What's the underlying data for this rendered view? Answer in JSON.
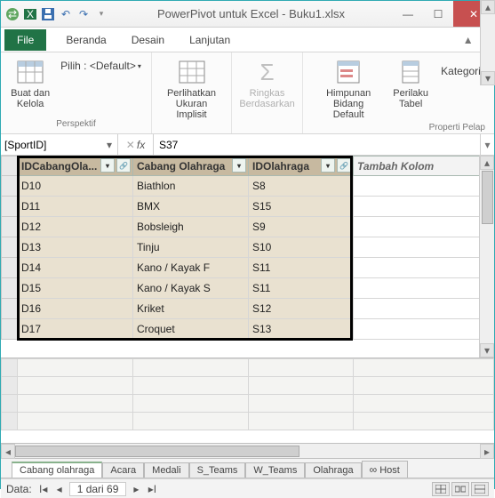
{
  "window": {
    "title": "PowerPivot untuk Excel - Buku1.xlsx"
  },
  "menu": {
    "file": "File",
    "home": "Beranda",
    "design": "Desain",
    "advanced": "Lanjutan"
  },
  "ribbon": {
    "build_manage": "Buat dan\nKelola",
    "pilih": "Pilih : <Default>",
    "group_perspektif": "Perspektif",
    "show_implicit": "Perlihatkan\nUkuran Implisit",
    "summarize": "Ringkas\nBerdasarkan",
    "default_set": "Himpunan\nBidang Default",
    "table_behavior": "Perilaku\nTabel",
    "kategori": "Kategori",
    "group_props": "Properti Pelap"
  },
  "formula": {
    "name": "[SportID]",
    "value": "S37"
  },
  "columns": {
    "c1": "IDCabangOla...",
    "c2": "Cabang Olahraga",
    "c3": "IDOlahraga",
    "add": "Tambah Kolom"
  },
  "rows": [
    {
      "c1": "D10",
      "c2": "Biathlon",
      "c3": "S8"
    },
    {
      "c1": "D11",
      "c2": "BMX",
      "c3": "S15"
    },
    {
      "c1": "D12",
      "c2": "Bobsleigh",
      "c3": "S9"
    },
    {
      "c1": "D13",
      "c2": "Tinju",
      "c3": "S10"
    },
    {
      "c1": "D14",
      "c2": "Kano / Kayak F",
      "c3": "S11"
    },
    {
      "c1": "D15",
      "c2": "Kano / Kayak S",
      "c3": "S11"
    },
    {
      "c1": "D16",
      "c2": "Kriket",
      "c3": "S12"
    },
    {
      "c1": "D17",
      "c2": "Croquet",
      "c3": "S13"
    }
  ],
  "tabs": [
    "Cabang olahraga",
    "Acara",
    "Medali",
    "S_Teams",
    "W_Teams",
    "Olahraga",
    "Host"
  ],
  "active_tab": 0,
  "status": {
    "label": "Data:",
    "record": "1 dari 69"
  }
}
